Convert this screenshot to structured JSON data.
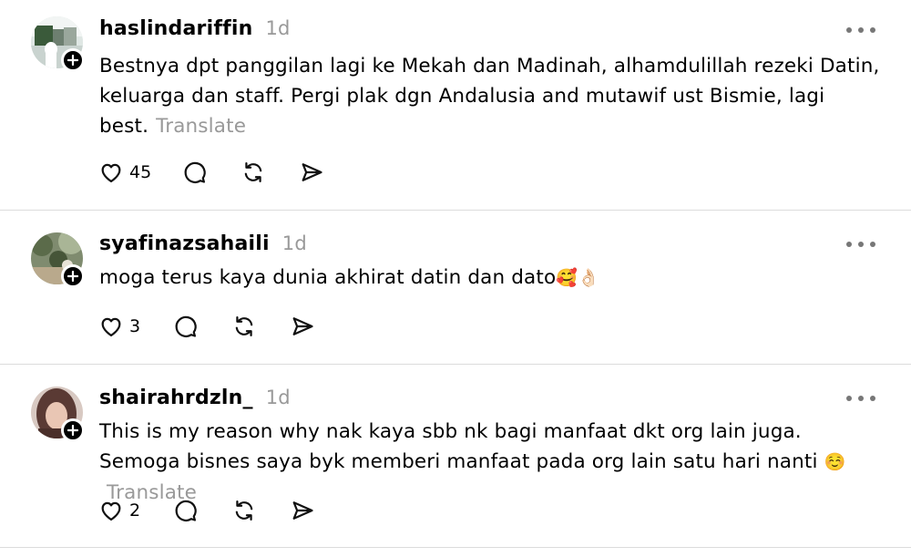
{
  "translate_label": "Translate",
  "posts": [
    {
      "username": "haslindariffin",
      "time": "1d",
      "text": "Bestnya dpt panggilan lagi ke Mekah dan Madinah, alhamdulillah rezeki Datin, keluarga dan staff. Pergi plak dgn Andalusia and mutawif ust Bismie, lagi best.",
      "likes": "45"
    },
    {
      "username": "syafinazsahaili",
      "time": "1d",
      "text": "moga terus kaya dunia akhirat datin dan dato",
      "emoji": "🥰👌🏻",
      "likes": "3"
    },
    {
      "username": "shairahrdzln_",
      "time": "1d",
      "text": "This is my reason why nak kaya sbb nk bagi manfaat dkt org lain juga. Semoga bisnes saya byk memberi manfaat pada org lain satu hari nanti",
      "emoji": "☺️",
      "likes": "2"
    }
  ]
}
